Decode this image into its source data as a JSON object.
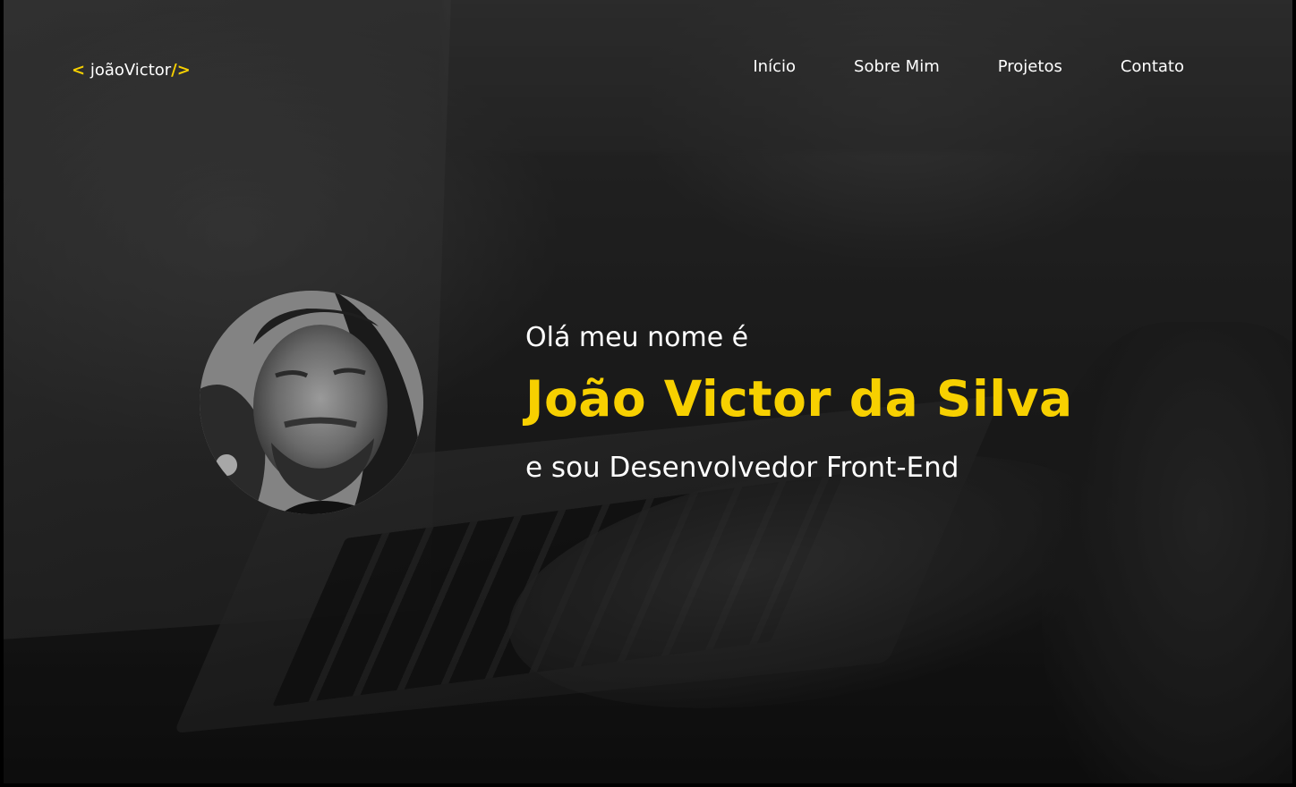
{
  "header": {
    "logo": {
      "open_bracket": "<",
      "name": "joãoVictor",
      "close_bracket": "/>"
    },
    "nav": [
      {
        "label": "Início"
      },
      {
        "label": "Sobre Mim"
      },
      {
        "label": "Projetos"
      },
      {
        "label": "Contato"
      }
    ]
  },
  "hero": {
    "intro": "Olá meu nome é",
    "name": "João Victor da Silva",
    "role": "e sou Desenvolvedor Front-End",
    "avatar_icon": "profile-photo"
  },
  "colors": {
    "accent": "#f7d000",
    "text": "#ffffff",
    "background": "#2a2a2a"
  }
}
